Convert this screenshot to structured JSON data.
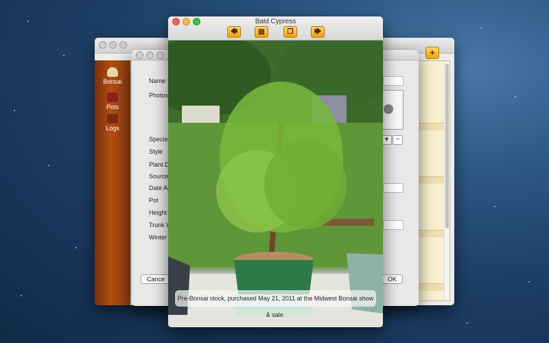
{
  "background": {
    "desktop": "mac-galaxy-wallpaper"
  },
  "library_window": {
    "sidebar": {
      "items": [
        {
          "label": "Bonsai",
          "icon": "bonsai-icon"
        },
        {
          "label": "Pots",
          "icon": "pots-icon"
        },
        {
          "label": "Logs",
          "icon": "logs-icon"
        }
      ]
    },
    "add_button": "+"
  },
  "editor_dialog": {
    "labels": [
      "Name",
      "Photos",
      "Species",
      "Style",
      "Plant Da",
      "Source",
      "Date Ac",
      "Pot",
      "Height",
      "Trunk W",
      "Winter"
    ],
    "remove_button": "−",
    "cancel_button": "Cance",
    "ok_button": "OK"
  },
  "viewer": {
    "title": "Bald Cypress",
    "caption": "Pre-Bonsai stock, purchased May 21, 2011 at the Midwest Bonsai show & sale.",
    "toolbar": [
      {
        "name": "previous-photo-button",
        "glyph": "🡄"
      },
      {
        "name": "caption-button",
        "glyph": "▤"
      },
      {
        "name": "copy-photo-button",
        "glyph": "❐"
      },
      {
        "name": "next-photo-button",
        "glyph": "🡆"
      }
    ]
  },
  "colors": {
    "accent": "#efa10f",
    "sidebar_wood": "#b24e14"
  }
}
